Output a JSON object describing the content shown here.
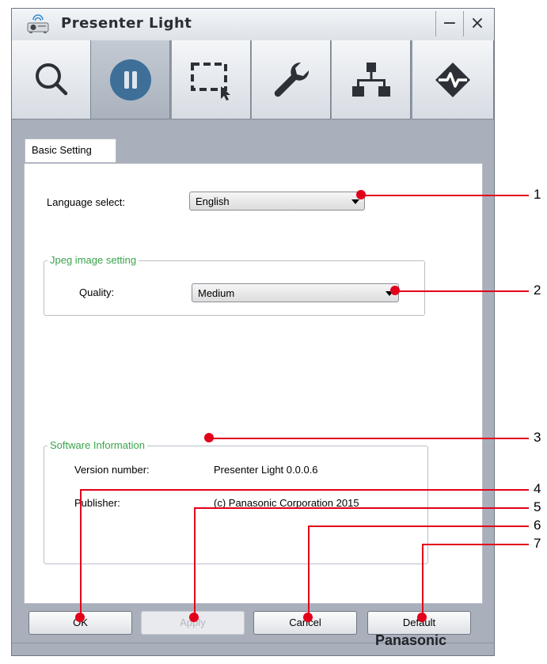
{
  "window": {
    "title": "Presenter Light",
    "minimize_label": "−",
    "close_label": "×"
  },
  "toolbar": {
    "tools": [
      {
        "name": "search-icon"
      },
      {
        "name": "pause-icon"
      },
      {
        "name": "area-select-icon"
      },
      {
        "name": "wrench-icon"
      },
      {
        "name": "network-icon"
      },
      {
        "name": "diamond-icon"
      }
    ]
  },
  "tab": {
    "label": "Basic Setting"
  },
  "language": {
    "label": "Language select:",
    "value": "English"
  },
  "jpeg": {
    "legend": "Jpeg image setting",
    "quality_label": "Quality:",
    "quality_value": "Medium"
  },
  "software": {
    "legend": "Software Information",
    "version_label": "Version number:",
    "version_value": "Presenter Light 0.0.0.6",
    "publisher_label": "Publisher:",
    "publisher_value": "(c) Panasonic Corporation 2015"
  },
  "buttons": {
    "ok": "OK",
    "apply": "Apply",
    "cancel": "Cancel",
    "default": "Default"
  },
  "brand": "Panasonic",
  "callouts": [
    "1",
    "2",
    "3",
    "4",
    "5",
    "6",
    "7"
  ],
  "colors": {
    "accent_green": "#3aa34b",
    "callout_red": "#e2001a",
    "active_blue": "#3d6f99"
  }
}
